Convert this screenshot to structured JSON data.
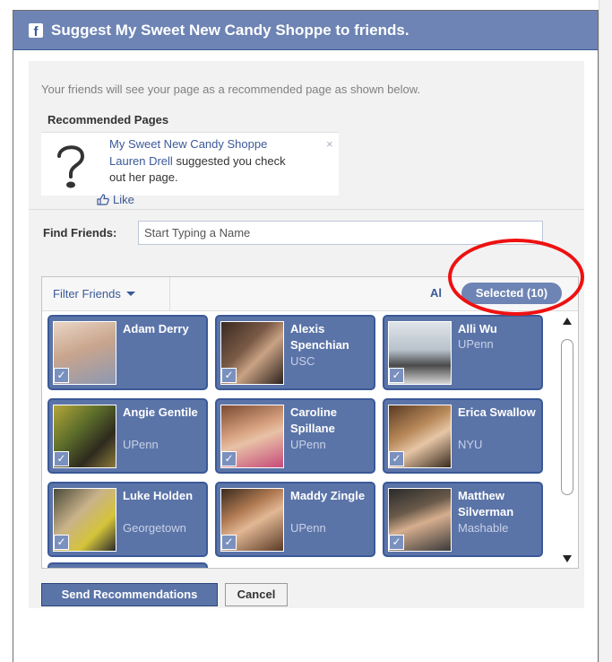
{
  "dialog": {
    "logo": "f",
    "title": "Suggest My Sweet New Candy Shoppe to friends."
  },
  "intro": "Your friends will see your page as a recommended page as shown below.",
  "recommended": {
    "header": "Recommended Pages",
    "page_name": "My Sweet New Candy Shoppe",
    "close": "×",
    "suggester": "Lauren Drell",
    "message": " suggested you check out her page.",
    "like_label": "Like"
  },
  "find": {
    "label": "Find Friends:",
    "placeholder": "Start Typing a Name"
  },
  "toolbar": {
    "filter_label": "Filter Friends",
    "all_label": "Al",
    "selected_label": "Selected (10)"
  },
  "friends": [
    {
      "name": "Adam Derry",
      "network": ""
    },
    {
      "name": "Alexis Spenchian",
      "network": "USC"
    },
    {
      "name": "Alli Wu",
      "network": "UPenn"
    },
    {
      "name": "Angie Gentile",
      "network": "UPenn"
    },
    {
      "name": "Caroline Spillane",
      "network": "UPenn"
    },
    {
      "name": "Erica Swallow",
      "network": "NYU"
    },
    {
      "name": "Luke Holden",
      "network": "Georgetown"
    },
    {
      "name": "Maddy Zingle",
      "network": "UPenn"
    },
    {
      "name": "Matthew Silverman",
      "network": "Mashable"
    }
  ],
  "actions": {
    "send_label": "Send Recommendations",
    "cancel_label": "Cancel"
  },
  "colors": {
    "header": "#6d84b4",
    "card": "#5b74a8",
    "card_border": "#3b5998",
    "annotation": "#ee1111"
  }
}
